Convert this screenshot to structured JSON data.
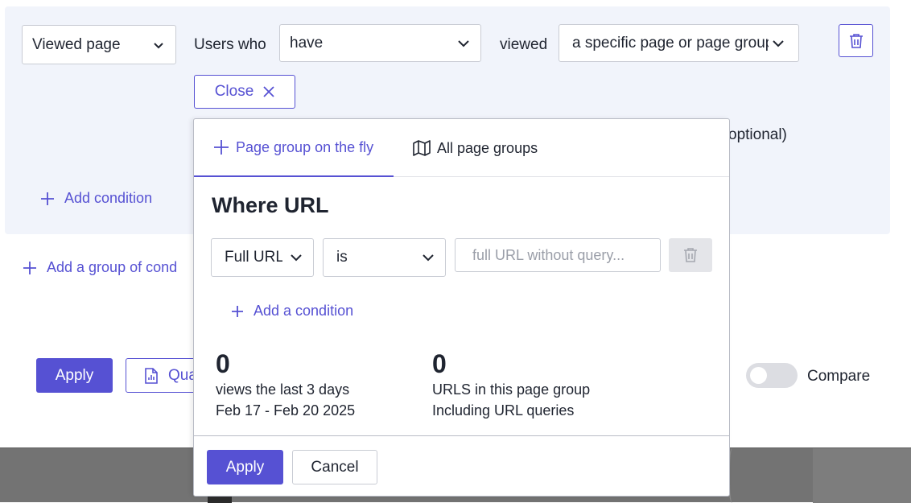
{
  "condition": {
    "type_select": "Viewed page",
    "users_who_label": "Users who",
    "have_select": "have",
    "viewed_label": "viewed",
    "target_select": "a specific page or page group",
    "close_label": "Close",
    "optional_text": "optional)",
    "add_condition": "Add condition"
  },
  "add_group": "Add a group of cond",
  "actions": {
    "apply_label": "Apply",
    "quick_label": "Qua",
    "compare_label": "Compare"
  },
  "popup": {
    "tabs": [
      {
        "label": "Page group on the fly",
        "icon": "plus-icon",
        "active": true
      },
      {
        "label": "All page groups",
        "icon": "map-icon",
        "active": false
      }
    ],
    "title": "Where URL",
    "url_type_select": "Full URL",
    "operator_select": "is",
    "url_input_placeholder": "full URL without query...",
    "add_a_condition": "Add a condition",
    "stats": {
      "views_count": "0",
      "views_label": "views the last 3 days",
      "date_range": "Feb 17 - Feb 20 2025",
      "urls_count": "0",
      "urls_label": "URLS in this page group",
      "urls_sub": "Including URL queries"
    },
    "apply_label": "Apply",
    "cancel_label": "Cancel"
  },
  "colors": {
    "accent": "#5651d3",
    "panel_bg": "#f1f4fb"
  }
}
